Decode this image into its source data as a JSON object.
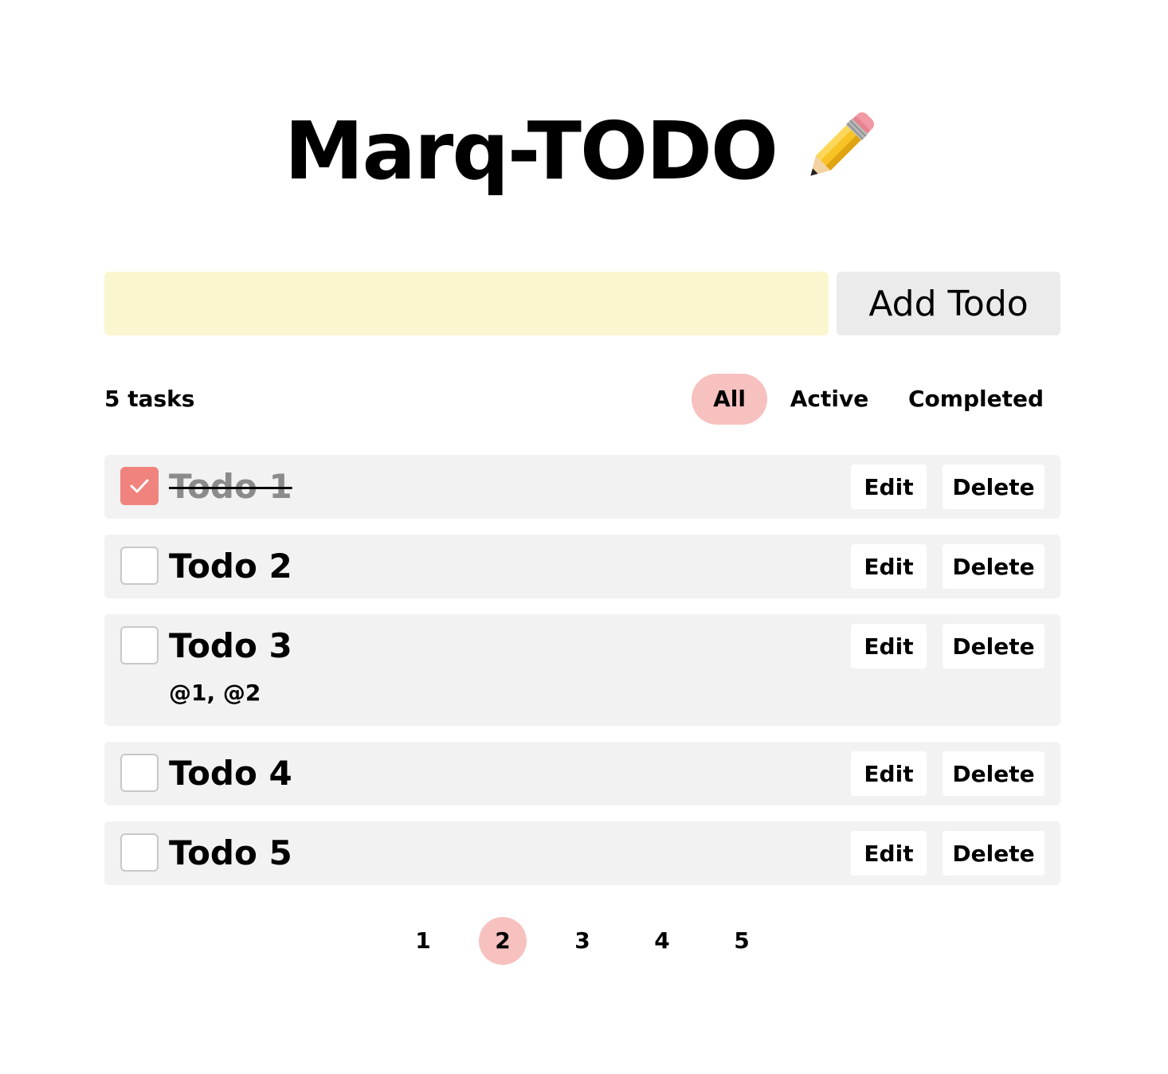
{
  "header": {
    "title": "Marq-TODO",
    "title_icon": "pencil-icon"
  },
  "add_form": {
    "input_value": "",
    "input_placeholder": "",
    "add_label": "Add Todo"
  },
  "filters": {
    "count_label": "5 tasks",
    "options": [
      "All",
      "Active",
      "Completed"
    ],
    "selected": "All"
  },
  "todos": [
    {
      "text": "Todo 1",
      "completed": true,
      "meta": ""
    },
    {
      "text": "Todo 2",
      "completed": false,
      "meta": ""
    },
    {
      "text": "Todo 3",
      "completed": false,
      "meta": "@1, @2"
    },
    {
      "text": "Todo 4",
      "completed": false,
      "meta": ""
    },
    {
      "text": "Todo 5",
      "completed": false,
      "meta": ""
    }
  ],
  "item_actions": {
    "edit_label": "Edit",
    "delete_label": "Delete"
  },
  "pagination": {
    "pages": [
      "1",
      "2",
      "3",
      "4",
      "5"
    ],
    "current": "2"
  },
  "colors": {
    "input_bg": "#faf6cf",
    "accent_pink": "#f7c1c0",
    "checkbox_checked": "#f0837d",
    "item_bg": "#f2f2f2"
  }
}
